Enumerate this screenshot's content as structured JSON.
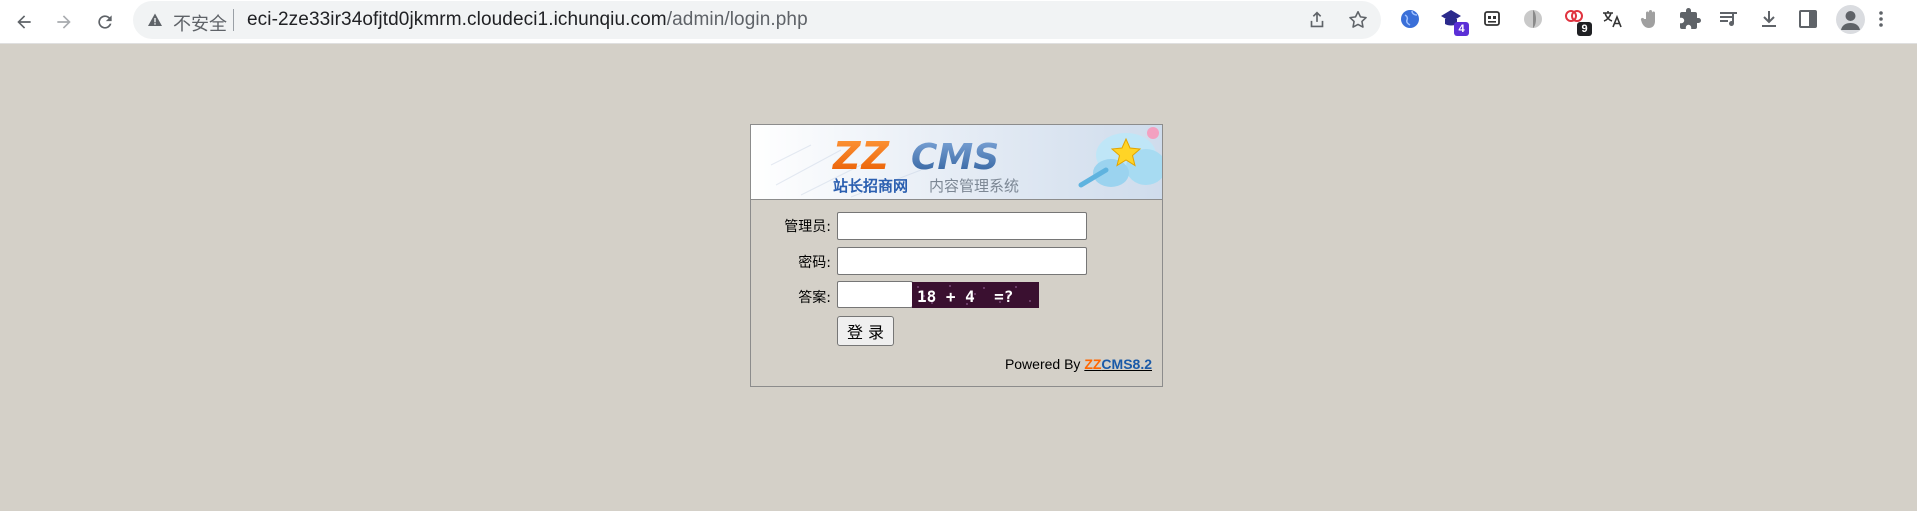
{
  "browser": {
    "security_status": "不安全",
    "url_host": "eci-2ze33ir34ofjtd0jkmrm.cloudeci1.ichunqiu.com",
    "url_path": "/admin/login.php",
    "extensions": [
      {
        "icon": "globe-icon"
      },
      {
        "icon": "graduation-cap-icon",
        "badge": "4",
        "badge_color": "#5b2fd6"
      },
      {
        "icon": "robot-icon"
      },
      {
        "icon": "swirl-icon"
      },
      {
        "icon": "pin-icon",
        "badge": "9",
        "badge_color": "#202124"
      },
      {
        "icon": "translate-icon"
      },
      {
        "icon": "hand-icon"
      },
      {
        "icon": "puzzle-icon"
      },
      {
        "icon": "playlist-icon"
      },
      {
        "icon": "download-icon"
      },
      {
        "icon": "side-panel-icon"
      }
    ]
  },
  "login": {
    "logo_brand": "ZZCMS",
    "logo_subtitle_blue": "站长招商网",
    "logo_subtitle_gray": "内容管理系统",
    "admin_label": "管理员:",
    "admin_value": "",
    "password_label": "密码:",
    "password_value": "",
    "answer_label": "答案:",
    "answer_value": "",
    "captcha_text": "18 + 4  =?",
    "submit_label": "登 录",
    "powered_prefix": "Powered By ",
    "powered_zz": "ZZ",
    "powered_cms": "CMS8.2"
  },
  "colors": {
    "page_background": "#d4d0c8",
    "brand_orange": "#ff6600",
    "brand_blue": "#1a5aa8",
    "captcha_background": "#3a1030"
  }
}
